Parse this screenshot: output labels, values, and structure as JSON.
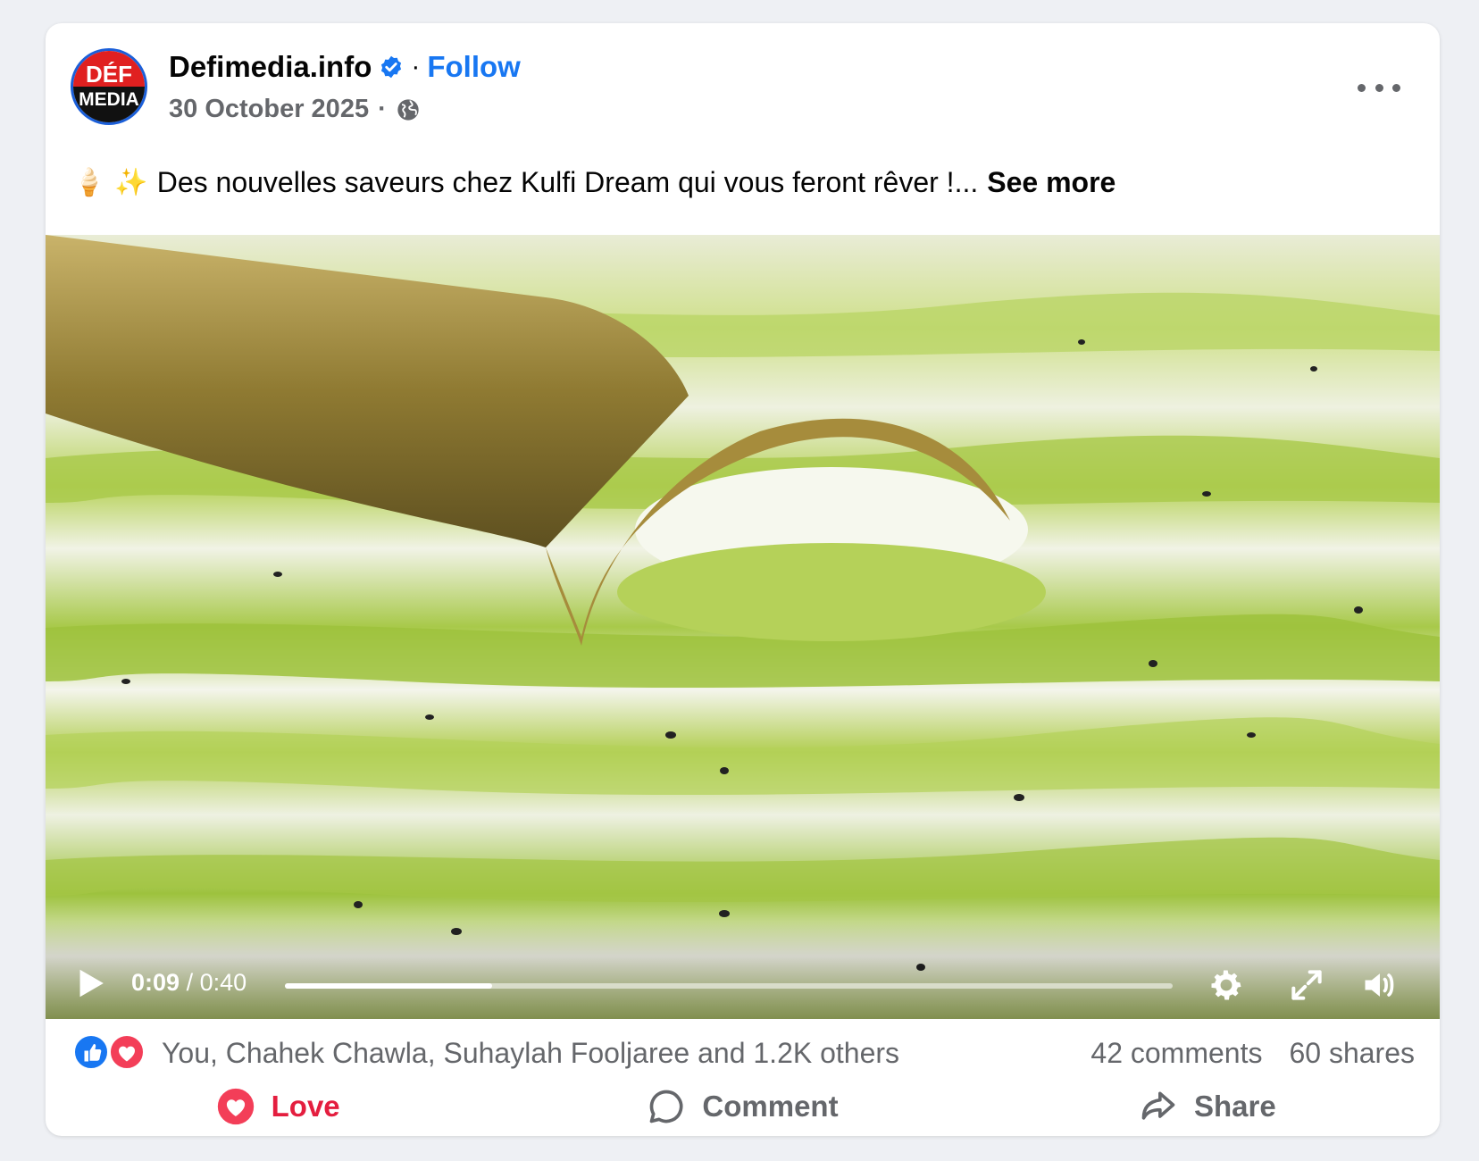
{
  "post": {
    "page_name": "Defimedia.info",
    "follow_label": "Follow",
    "separator": "·",
    "date": "30 October 2025",
    "date_separator": "·",
    "avatar": {
      "top_text": "DÉF",
      "bottom_text": "MEDIA"
    },
    "caption": {
      "emoji_1": "🍦",
      "emoji_2": "✨",
      "text": "Des nouvelles saveurs chez Kulfi Dream qui vous feront rêver !...",
      "see_more": "See more"
    }
  },
  "video": {
    "current_time": "0:09",
    "duration_text": "/ 0:40",
    "progress_fraction": 0.233
  },
  "reactions": {
    "names": "You, Chahek Chawla, Suhaylah Fooljaree and 1.2K others",
    "comments": "42 comments",
    "shares": "60 shares"
  },
  "actions": {
    "love": "Love",
    "comment": "Comment",
    "share": "Share"
  },
  "colors": {
    "brand_blue": "#1877f2",
    "love_red": "#e41e3f",
    "secondary_text": "#65676b"
  }
}
